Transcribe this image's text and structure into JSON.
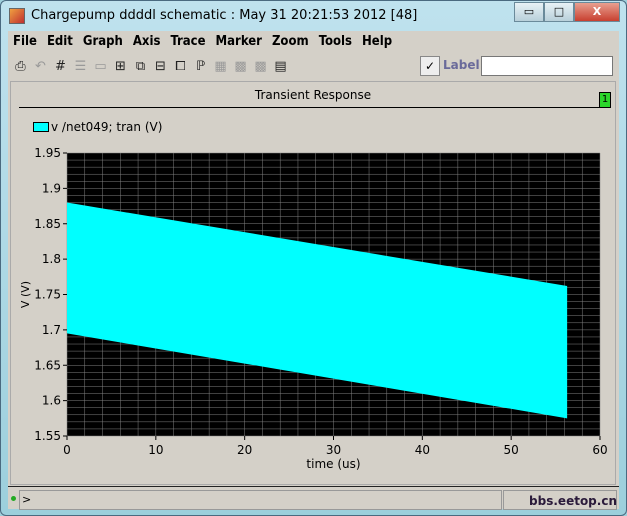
{
  "window": {
    "title": "Chargepump ddddl schematic : May 31 20:21:53 2012 [48]",
    "minimize": "▭",
    "maximize": "□",
    "close": "X"
  },
  "menu": [
    "File",
    "Edit",
    "Graph",
    "Axis",
    "Trace",
    "Marker",
    "Zoom",
    "Tools",
    "Help"
  ],
  "toolbar": {
    "icons": [
      "print-icon",
      "undo-icon",
      "grid-icon",
      "strips-icon",
      "overlay-icon",
      "split-icon",
      "zoom-in-icon",
      "fit-icon",
      "zoom-out-icon",
      "marker-icon",
      "table-icon",
      "hatch-icon",
      "hatch2-icon",
      "calculator-icon"
    ],
    "label_check": "✓",
    "label_text": "Label",
    "label_value": ""
  },
  "panel": {
    "title": "Transient Response",
    "badge": "1",
    "legend": "v /net049; tran (V)"
  },
  "status": {
    "prompt": ">"
  },
  "watermark": "bbs.eetop.cn",
  "colors": {
    "trace": "#00ffff",
    "plot_bg": "#000000",
    "grid": "#808080"
  },
  "chart_data": {
    "type": "area",
    "title": "Transient Response",
    "xlabel": "time (us)",
    "ylabel": "V (V)",
    "xlim": [
      0,
      60
    ],
    "ylim": [
      1.55,
      1.95
    ],
    "xticks": [
      0,
      10,
      20,
      30,
      40,
      50,
      60
    ],
    "yticks": [
      1.55,
      1.6,
      1.65,
      1.7,
      1.75,
      1.8,
      1.85,
      1.9,
      1.95
    ],
    "series": [
      {
        "name": "v /net049; tran (V)",
        "x": [
          0,
          56.3
        ],
        "upper": [
          1.88,
          1.762
        ],
        "lower": [
          1.695,
          1.575
        ]
      }
    ]
  }
}
